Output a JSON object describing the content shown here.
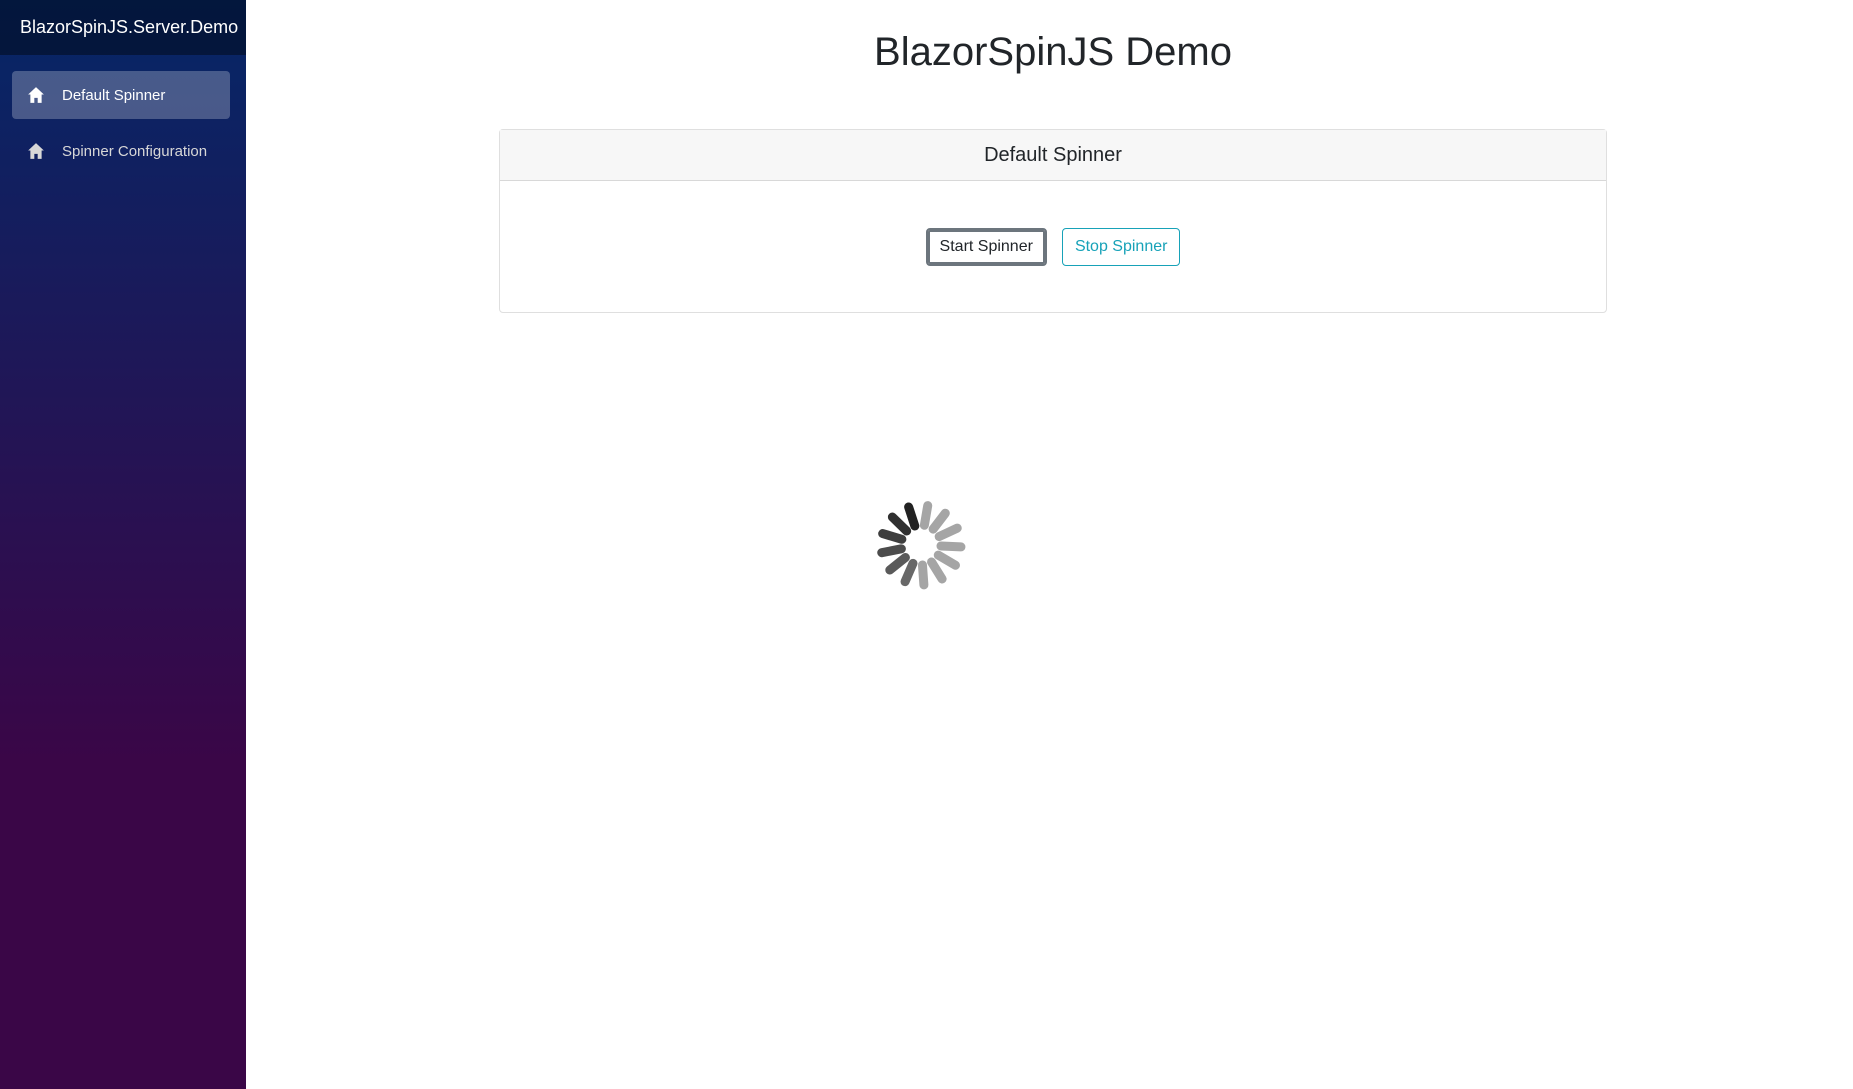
{
  "sidebar": {
    "brand": "BlazorSpinJS.Server.Demo",
    "items": [
      {
        "label": "Default Spinner",
        "icon": "home-icon",
        "active": true
      },
      {
        "label": "Spinner Configuration",
        "icon": "home-icon",
        "active": false
      }
    ]
  },
  "main": {
    "title": "BlazorSpinJS Demo",
    "card": {
      "header": "Default Spinner",
      "start_label": "Start Spinner",
      "stop_label": "Stop Spinner"
    }
  },
  "colors": {
    "sidebar_top": "#052767",
    "sidebar_bottom": "#3a0647",
    "stop_button": "#17a2b8"
  },
  "spinner": {
    "lines": 13,
    "active": true
  }
}
